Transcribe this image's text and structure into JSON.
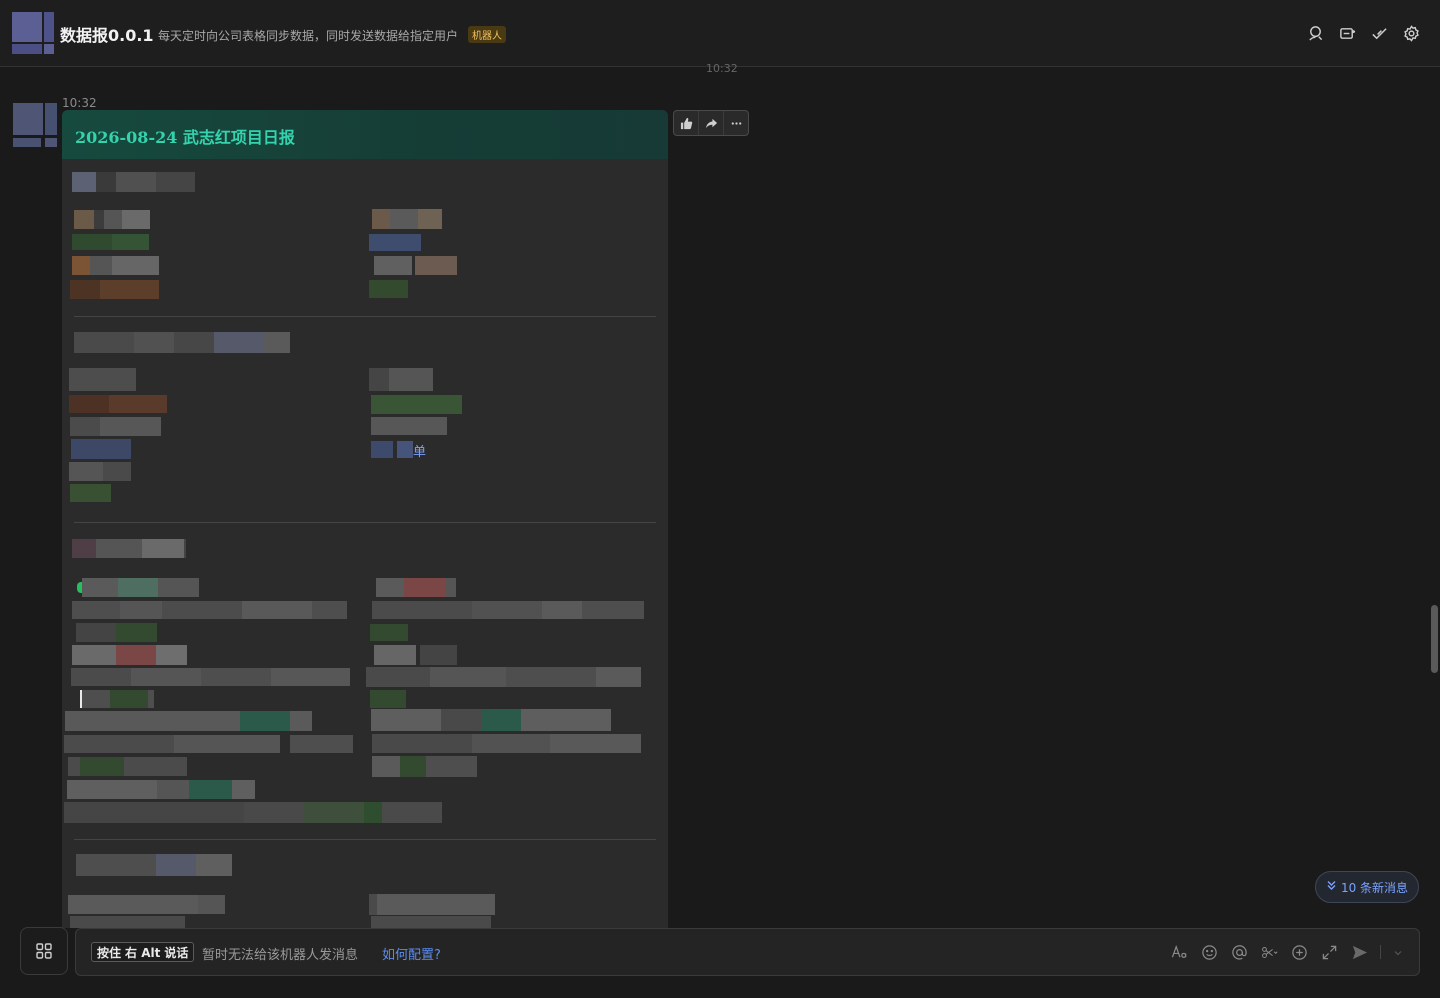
{
  "header": {
    "title": "数据报0.0.1",
    "subtitle": "每天定时向公司表格同步数据，同时发送数据给指定用户",
    "bot_badge": "机器人",
    "icons": [
      "search-user-icon",
      "add-chat-icon",
      "mark-done-icon",
      "settings-icon"
    ]
  },
  "timeline": {
    "prev_time": "10:32"
  },
  "message": {
    "time": "10:32",
    "card_title": "2026-08-24 武志红项目日报",
    "visible_fragment": "单",
    "actions": [
      "thumbs-up-icon",
      "forward-icon",
      "more-icon"
    ]
  },
  "new_messages": {
    "label": "10 条新消息"
  },
  "composer": {
    "push_to_talk_parts": [
      "按住",
      "右 Alt",
      "说话"
    ],
    "cannot_message": "暂时无法给该机器人发消息",
    "how_to_configure": "如何配置?",
    "tools": [
      "font-format-icon",
      "emoji-icon",
      "mention-icon",
      "screenshot-icon",
      "add-icon",
      "expand-icon",
      "send-icon"
    ]
  },
  "colors": {
    "background": "#1a1a1a",
    "card_title": "#34d3ad",
    "link": "#5b8def",
    "badge": "#f1c05b"
  }
}
